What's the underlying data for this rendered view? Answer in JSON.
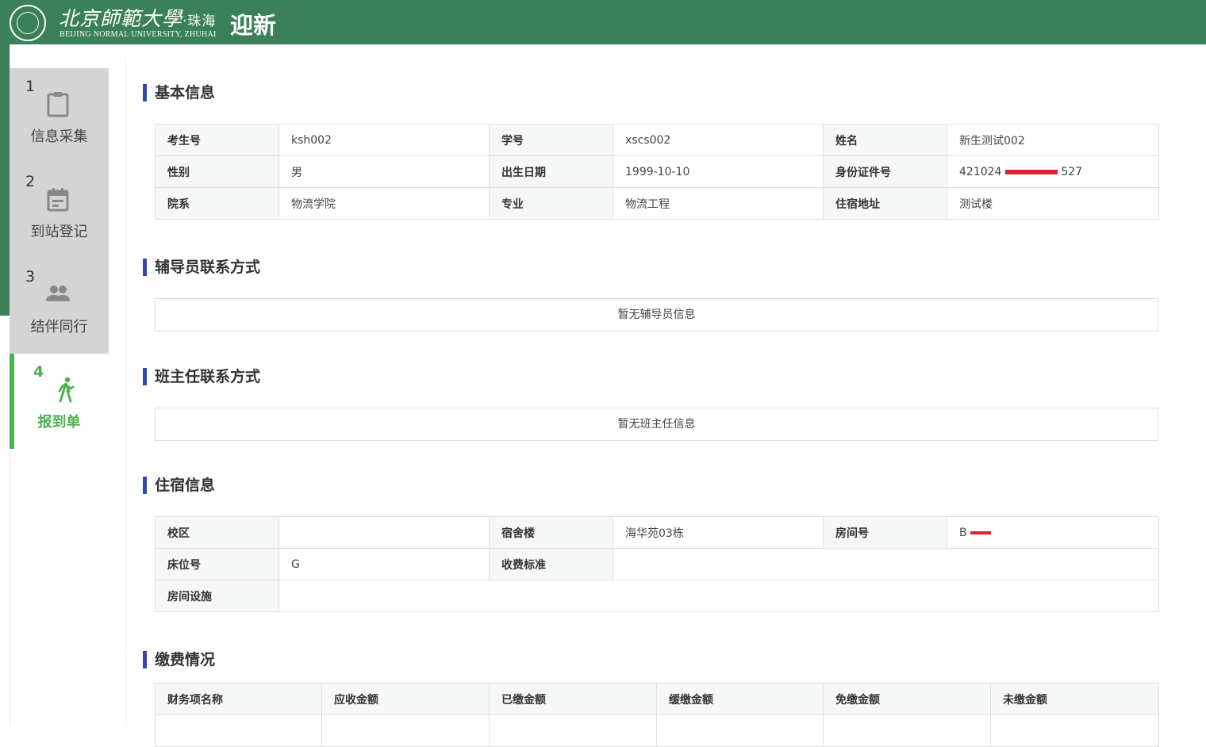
{
  "header": {
    "logo_cn": "北京師範大學",
    "logo_cn_suffix": "·珠海",
    "logo_en": "BEIJING NORMAL UNIVERSITY, ZHUHAI",
    "app_title": "迎新"
  },
  "steps": [
    {
      "num": "1",
      "label": "信息采集",
      "icon": "clipboard-icon"
    },
    {
      "num": "2",
      "label": "到站登记",
      "icon": "calendar-icon"
    },
    {
      "num": "3",
      "label": "结伴同行",
      "icon": "people-icon"
    },
    {
      "num": "4",
      "label": "报到单",
      "icon": "walking-person-icon"
    }
  ],
  "basic": {
    "title": "基本信息",
    "rows": [
      [
        {
          "k": "考生号",
          "v": "ksh002"
        },
        {
          "k": "学号",
          "v": "xscs002"
        },
        {
          "k": "姓名",
          "v": "新生测试002"
        }
      ],
      [
        {
          "k": "性别",
          "v": "男"
        },
        {
          "k": "出生日期",
          "v": "1999-10-10"
        },
        {
          "k": "身份证件号",
          "v_pre": "421024",
          "v_post": "527"
        }
      ],
      [
        {
          "k": "院系",
          "v": "物流学院"
        },
        {
          "k": "专业",
          "v": "物流工程"
        },
        {
          "k": "住宿地址",
          "v": "测试楼"
        }
      ]
    ]
  },
  "counselor": {
    "title": "辅导员联系方式",
    "empty": "暂无辅导员信息"
  },
  "headteacher": {
    "title": "班主任联系方式",
    "empty": "暂无班主任信息"
  },
  "dorm": {
    "title": "住宿信息",
    "campus_label": "校区",
    "campus_value": "",
    "building_label": "宿舍楼",
    "building_value": "海华苑03栋",
    "room_label": "房间号",
    "room_value": "B",
    "bed_label": "床位号",
    "bed_value": "G",
    "fee_label": "收费标准",
    "fee_value": "",
    "facility_label": "房间设施",
    "facility_value": ""
  },
  "payment": {
    "title": "缴费情况",
    "columns": [
      "财务项名称",
      "应收金额",
      "已缴金额",
      "缓缴金额",
      "免缴金额",
      "未缴金额"
    ]
  },
  "colors": {
    "header_green": "#3a8058",
    "active_green": "#4cb050",
    "section_bar": "#3349a8",
    "redaction": "#e0202a"
  }
}
